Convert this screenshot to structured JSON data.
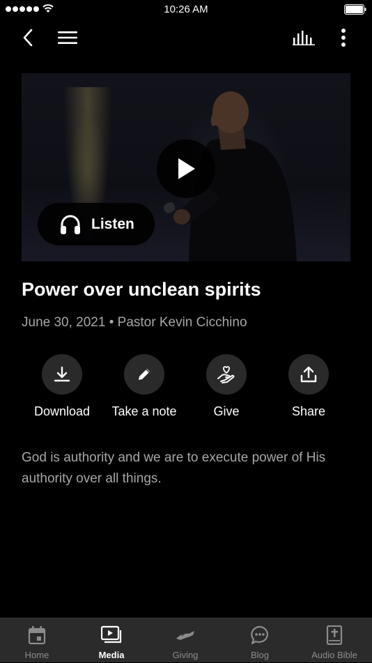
{
  "status_bar": {
    "time": "10:26 AM"
  },
  "hero": {
    "listen_label": "Listen"
  },
  "sermon": {
    "title": "Power over unclean spirits",
    "meta": "June 30, 2021 • Pastor Kevin Cicchino",
    "description": "God is authority and we are to execute power of His authority over all things."
  },
  "actions": [
    {
      "label": "Download",
      "icon": "download-icon"
    },
    {
      "label": "Take a note",
      "icon": "pencil-icon"
    },
    {
      "label": "Give",
      "icon": "give-hand-heart-icon"
    },
    {
      "label": "Share",
      "icon": "share-icon"
    }
  ],
  "tab_bar": {
    "active": "Media",
    "tabs": [
      {
        "label": "Home",
        "icon": "calendar-icon"
      },
      {
        "label": "Media",
        "icon": "media-play-icon"
      },
      {
        "label": "Giving",
        "icon": "giving-hands-icon"
      },
      {
        "label": "Blog",
        "icon": "chat-bubble-icon"
      },
      {
        "label": "Audio Bible",
        "icon": "bible-icon"
      }
    ]
  },
  "colors": {
    "background": "#000000",
    "secondary_text": "#a7a7a7",
    "action_circle": "#2a2a2a",
    "tab_bar": "#2b2b2b"
  }
}
